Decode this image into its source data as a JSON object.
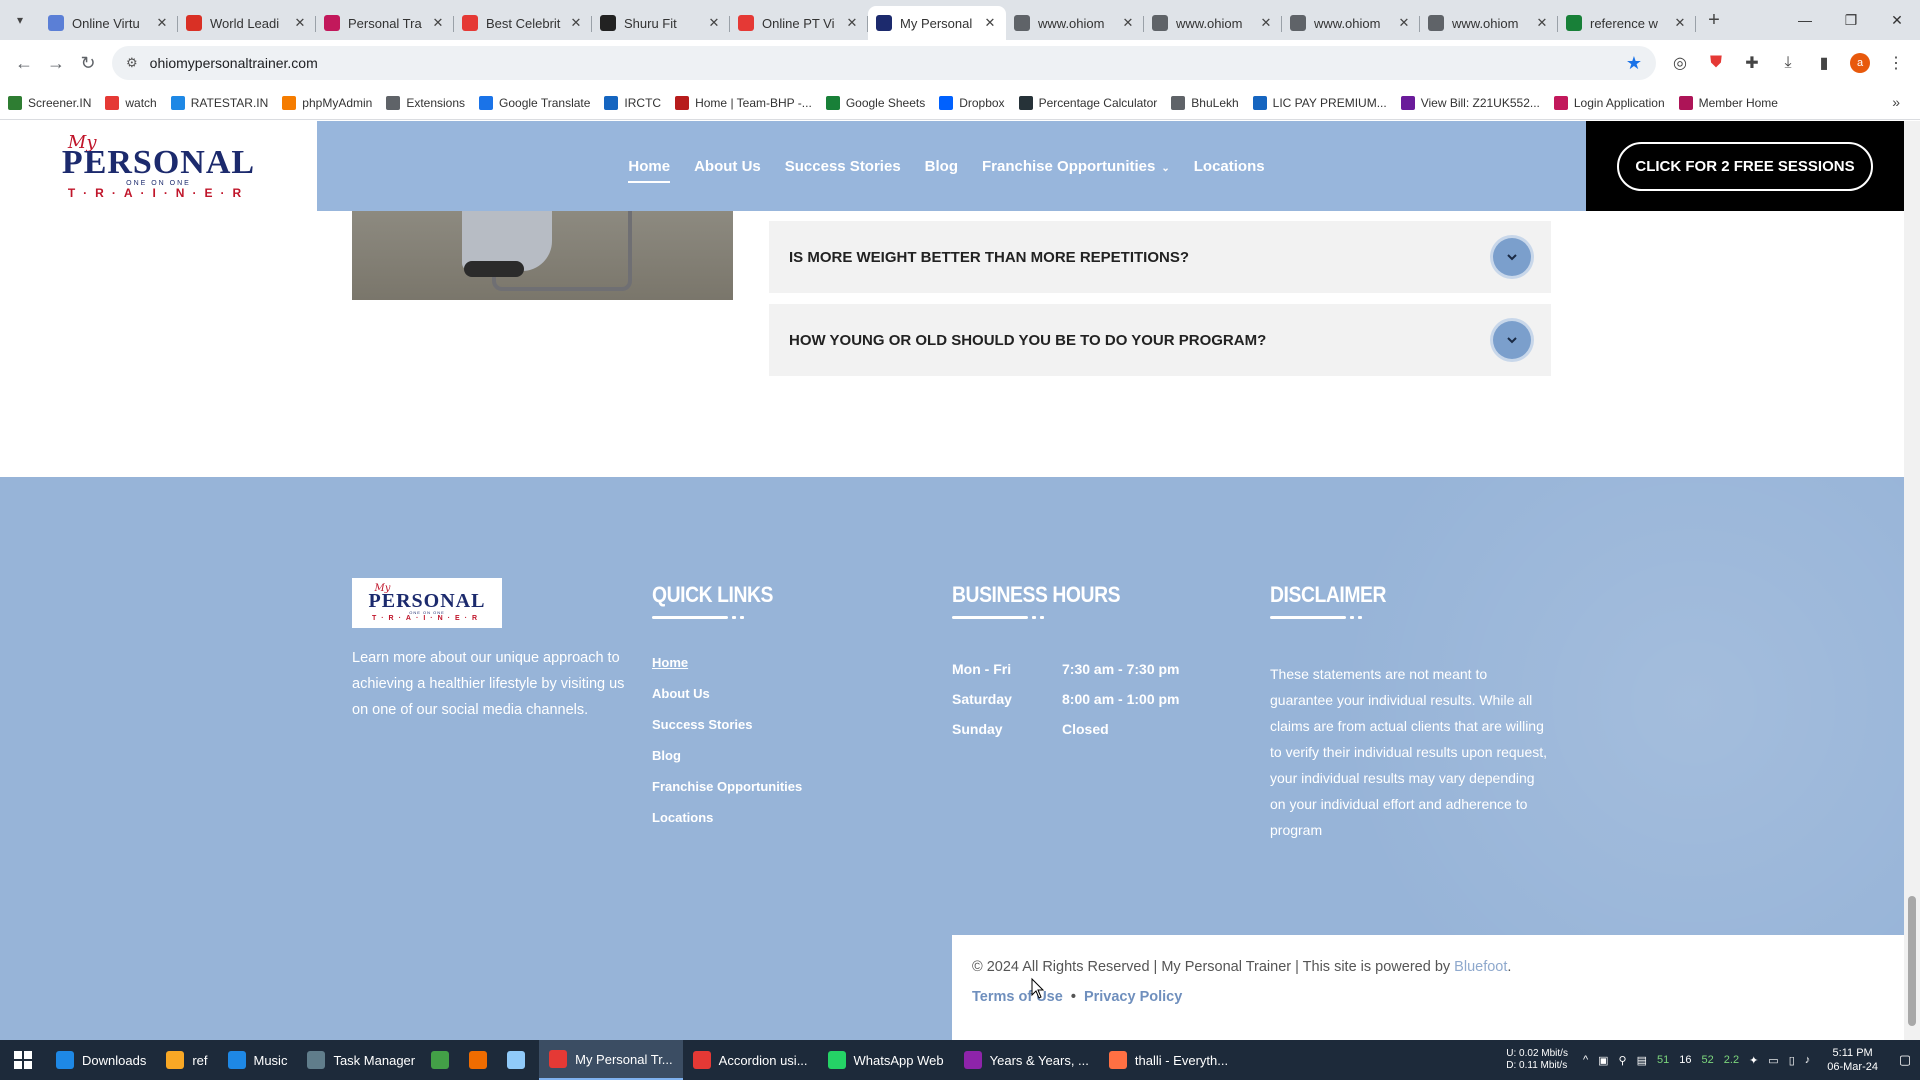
{
  "browser": {
    "tabs": [
      {
        "title": "Online Virtu",
        "favicon": "list-icon",
        "color": "#5b7fd6"
      },
      {
        "title": "World Leadi",
        "favicon": "up-icon",
        "color": "#d93025"
      },
      {
        "title": "Personal Tra",
        "favicon": "play-icon",
        "color": "#c2185b"
      },
      {
        "title": "Best Celebrit",
        "favicon": "b-icon",
        "color": "#e53935"
      },
      {
        "title": "Shuru Fit",
        "favicon": "shuru-icon",
        "color": "#222222"
      },
      {
        "title": "Online PT Vi",
        "favicon": "online-pt-icon",
        "color": "#e53935"
      },
      {
        "title": "My Personal",
        "favicon": "mpt-icon",
        "color": "#1c2a6d",
        "active": true
      },
      {
        "title": "www.ohiom",
        "favicon": "globe-icon",
        "color": "#5f6368"
      },
      {
        "title": "www.ohiom",
        "favicon": "globe-icon",
        "color": "#5f6368"
      },
      {
        "title": "www.ohiom",
        "favicon": "globe-icon",
        "color": "#5f6368"
      },
      {
        "title": "www.ohiom",
        "favicon": "globe-icon",
        "color": "#5f6368"
      },
      {
        "title": "reference w",
        "favicon": "sheets-icon",
        "color": "#188038"
      }
    ],
    "url": "ohiomypersonaltrainer.com",
    "profile_initial": "a",
    "bookmarks": [
      {
        "label": "Screener.IN",
        "icon": "chart-icon",
        "color": "#2e7d32"
      },
      {
        "label": "watch",
        "icon": "youtube-icon",
        "color": "#e53935"
      },
      {
        "label": "RATESTAR.IN",
        "icon": "ratestar-icon",
        "color": "#1e88e5"
      },
      {
        "label": "phpMyAdmin",
        "icon": "phpmyadmin-icon",
        "color": "#f57c00"
      },
      {
        "label": "Extensions",
        "icon": "puzzle-icon",
        "color": "#5f6368"
      },
      {
        "label": "Google Translate",
        "icon": "translate-icon",
        "color": "#1a73e8"
      },
      {
        "label": "IRCTC",
        "icon": "irctc-icon",
        "color": "#1565c0"
      },
      {
        "label": "Home | Team-BHP -...",
        "icon": "teambhp-icon",
        "color": "#b71c1c"
      },
      {
        "label": "Google Sheets",
        "icon": "sheets-icon",
        "color": "#188038"
      },
      {
        "label": "Dropbox",
        "icon": "dropbox-icon",
        "color": "#0061fe"
      },
      {
        "label": "Percentage Calculator",
        "icon": "percent-icon",
        "color": "#263238"
      },
      {
        "label": "BhuLekh",
        "icon": "globe-icon",
        "color": "#5f6368"
      },
      {
        "label": "LIC PAY PREMIUM...",
        "icon": "lic-icon",
        "color": "#1565c0"
      },
      {
        "label": "View Bill: Z21UK552...",
        "icon": "bill-icon",
        "color": "#6a1b9a"
      },
      {
        "label": "Login Application",
        "icon": "login-icon",
        "color": "#c2185b"
      },
      {
        "label": "Member Home",
        "icon": "member-icon",
        "color": "#ad1457"
      }
    ]
  },
  "site": {
    "logo": {
      "my": "My",
      "personal": "PERSONAL",
      "tagline": "ONE ON ONE",
      "trainer": "T·R·A·I·N·E·R"
    },
    "nav": [
      {
        "label": "Home",
        "active": true
      },
      {
        "label": "About Us"
      },
      {
        "label": "Success Stories"
      },
      {
        "label": "Blog"
      },
      {
        "label": "Franchise Opportunities",
        "dropdown": true
      },
      {
        "label": "Locations"
      }
    ],
    "cta": "CLICK FOR 2 FREE SESSIONS",
    "faq": [
      "IS MORE WEIGHT BETTER THAN MORE REPETITIONS?",
      "HOW YOUNG OR OLD SHOULD YOU BE TO DO YOUR PROGRAM?"
    ]
  },
  "footer": {
    "about": "Learn more about our unique approach to achieving a healthier lifestyle by visiting us on one of our social media channels.",
    "quick_links": {
      "heading": "QUICK LINKS",
      "items": [
        "Home",
        "About Us",
        "Success Stories",
        "Blog",
        "Franchise Opportunities",
        "Locations"
      ]
    },
    "hours": {
      "heading": "BUSINESS HOURS",
      "rows": [
        {
          "day": "Mon - Fri",
          "time": "7:30 am - 7:30 pm"
        },
        {
          "day": "Saturday",
          "time": "8:00 am - 1:00 pm"
        },
        {
          "day": "Sunday",
          "time": "Closed"
        }
      ]
    },
    "disclaimer": {
      "heading": "DISCLAIMER",
      "text": "These statements are not meant to guarantee your individual results. While all claims are from actual clients that are willing to verify their individual results upon request, your individual results may vary depending on your individual effort and adherence to program"
    },
    "copyright": {
      "text": "© 2024 All Rights Reserved | My Personal Trainer | This site is powered by ",
      "brand": "Bluefoot",
      "period": ".",
      "terms": "Terms of Use",
      "separator": "•",
      "privacy": "Privacy Policy"
    }
  },
  "taskbar": {
    "items": [
      {
        "label": "Downloads",
        "icon": "download-icon",
        "color": "#1e88e5"
      },
      {
        "label": "ref",
        "icon": "folder-icon",
        "color": "#f9a825"
      },
      {
        "label": "Music",
        "icon": "music-icon",
        "color": "#1e88e5"
      },
      {
        "label": "Task Manager",
        "icon": "task-manager-icon",
        "color": "#607d8b"
      },
      {
        "label": "",
        "icon": "spreadsheet-icon",
        "color": "#43a047"
      },
      {
        "label": "",
        "icon": "app-icon",
        "color": "#ef6c00"
      },
      {
        "label": "",
        "icon": "notepad-icon",
        "color": "#90caf9"
      },
      {
        "label": "My Personal Tr...",
        "icon": "chrome-icon",
        "color": "#e53935",
        "active": true
      },
      {
        "label": "Accordion usi...",
        "icon": "chrome-icon",
        "color": "#e53935"
      },
      {
        "label": "WhatsApp Web",
        "icon": "chrome-icon",
        "color": "#25d366"
      },
      {
        "label": "Years & Years, ...",
        "icon": "bird-icon",
        "color": "#8e24aa"
      },
      {
        "label": "thalli - Everyth...",
        "icon": "search-icon",
        "color": "#ff7043"
      }
    ],
    "net_up": "U:  0.02 Mbit/s",
    "net_down": "D:  0.11 Mbit/s",
    "tray_numbers": [
      "51",
      "16",
      "52",
      "2.2"
    ],
    "time": "5:11 PM",
    "date": "06-Mar-24"
  }
}
